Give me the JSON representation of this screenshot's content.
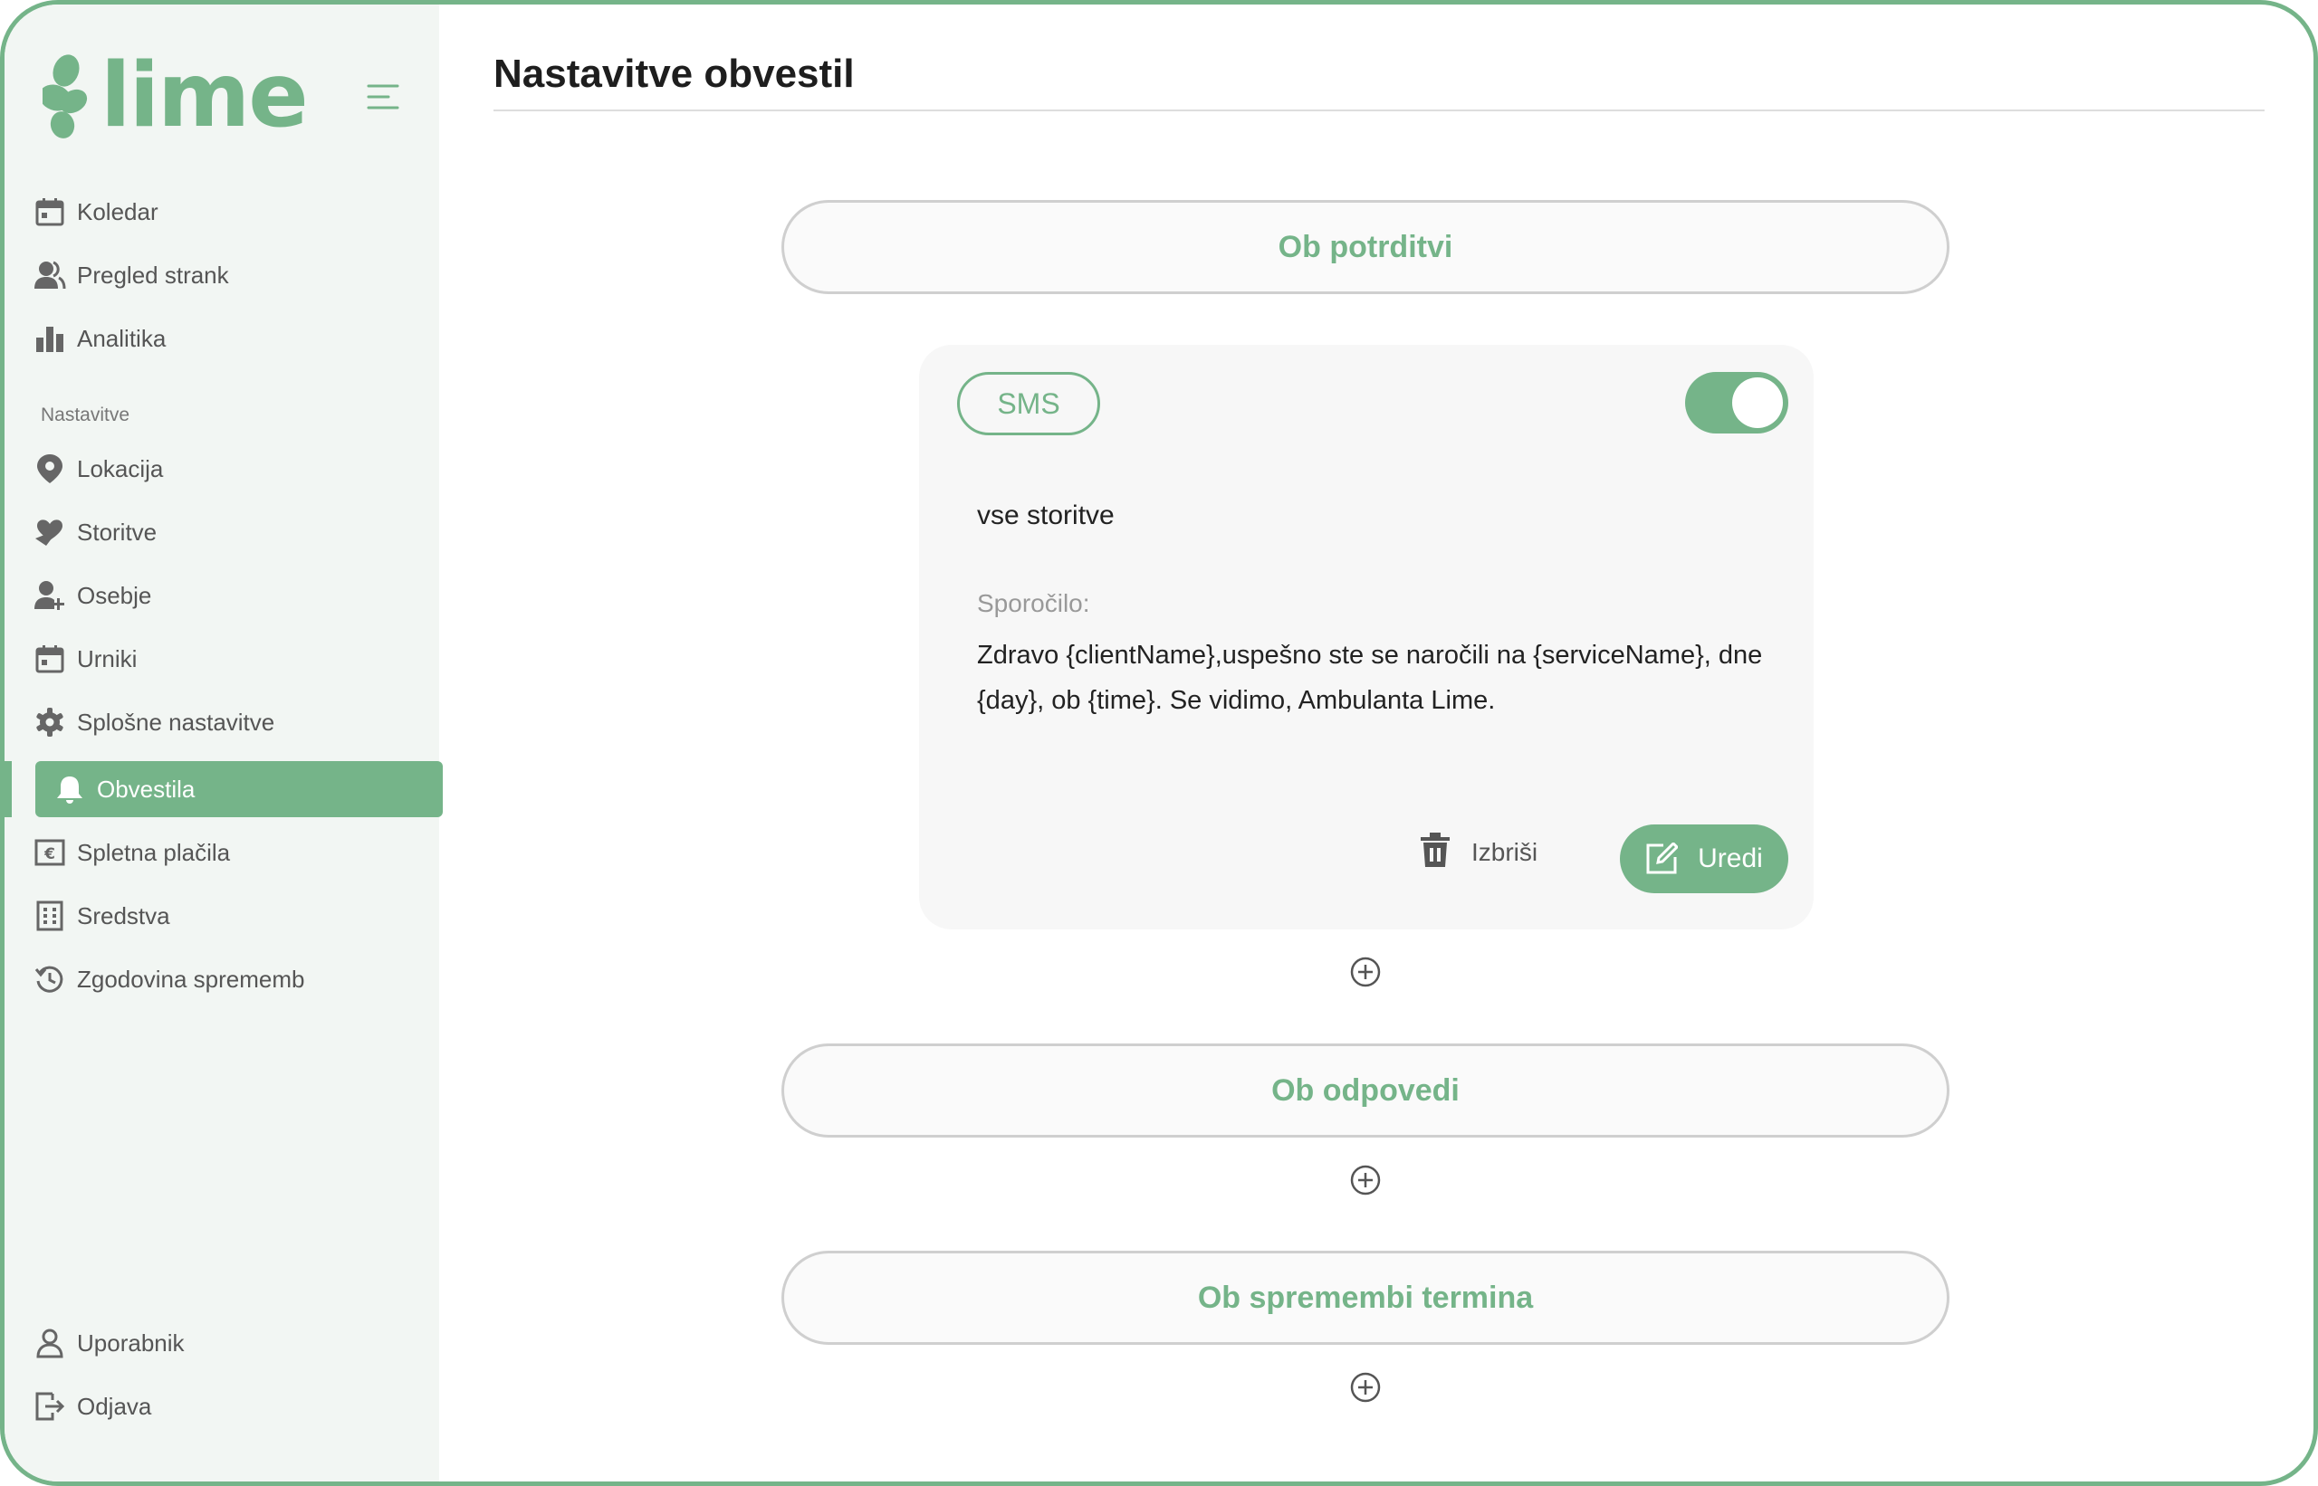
{
  "app": {
    "logo_text": "lime"
  },
  "colors": {
    "accent": "#75b489",
    "sidebar_bg": "#f2f6f3",
    "card_bg": "#f7f7f7"
  },
  "sidebar": {
    "items": [
      {
        "label": "Koledar",
        "icon": "calendar-icon"
      },
      {
        "label": "Pregled strank",
        "icon": "users-icon"
      },
      {
        "label": "Analitika",
        "icon": "bar-chart-icon"
      }
    ],
    "section_label": "Nastavitve",
    "settings_items": [
      {
        "label": "Lokacija",
        "icon": "location-pin-icon"
      },
      {
        "label": "Storitve",
        "icon": "heart-hand-icon"
      },
      {
        "label": "Osebje",
        "icon": "add-person-icon"
      },
      {
        "label": "Urniki",
        "icon": "calendar-icon"
      },
      {
        "label": "Splošne nastavitve",
        "icon": "gear-icon"
      },
      {
        "label": "Obvestila",
        "icon": "bell-icon",
        "active": true
      },
      {
        "label": "Spletna plačila",
        "icon": "euro-icon"
      },
      {
        "label": "Sredstva",
        "icon": "building-icon"
      },
      {
        "label": "Zgodovina sprememb",
        "icon": "history-icon"
      }
    ],
    "bottom_items": [
      {
        "label": "Uporabnik",
        "icon": "user-icon"
      },
      {
        "label": "Odjava",
        "icon": "logout-icon"
      }
    ]
  },
  "main": {
    "title": "Nastavitve obvestil",
    "sections": [
      {
        "label": "Ob potrditvi"
      },
      {
        "label": "Ob odpovedi"
      },
      {
        "label": "Ob spremembi termina"
      }
    ],
    "card": {
      "channel": "SMS",
      "enabled": true,
      "services": "vse storitve",
      "message_label": "Sporočilo:",
      "message": "Zdravo {clientName},uspešno ste se naročili na {serviceName}, dne {day}, ob {time}. Se vidimo, Ambulanta Lime.",
      "delete_label": "Izbriši",
      "edit_label": "Uredi"
    }
  }
}
